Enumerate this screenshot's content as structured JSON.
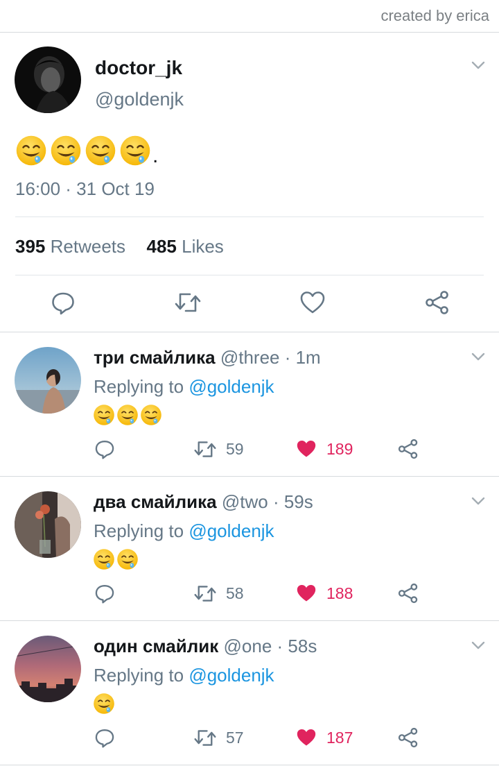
{
  "credit": "created by erica",
  "tweet": {
    "name": "doctor_jk",
    "handle": "@goldenjk",
    "body_emoji_count": 4,
    "body_suffix": ".",
    "timestamp": "16:00 · 31 Oct 19",
    "retweets_count": "395",
    "retweets_label": "Retweets",
    "likes_count": "485",
    "likes_label": "Likes"
  },
  "replies": [
    {
      "name": "три смайлика",
      "handle": "@three",
      "time": "· 1m",
      "replying_label": "Replying to",
      "replying_handle": "@goldenjk",
      "emoji_count": 3,
      "retweets": "59",
      "likes": "189",
      "liked": true
    },
    {
      "name": "два смайлика",
      "handle": "@two",
      "time": "· 59s",
      "replying_label": "Replying to",
      "replying_handle": "@goldenjk",
      "emoji_count": 2,
      "retweets": "58",
      "likes": "188",
      "liked": true
    },
    {
      "name": "один смайлик",
      "handle": "@one",
      "time": "· 58s",
      "replying_label": "Replying to",
      "replying_handle": "@goldenjk",
      "emoji_count": 1,
      "retweets": "57",
      "likes": "187",
      "liked": true
    }
  ],
  "icons": {
    "reply": "speech-bubble-icon",
    "retweet": "retweet-icon",
    "like": "heart-icon",
    "share": "share-icon",
    "chevron": "chevron-down-icon",
    "emoji": "drooling-face-emoji"
  },
  "colors": {
    "link": "#1b95e0",
    "muted": "#657786",
    "like": "#e0245e",
    "text": "#14171a"
  }
}
